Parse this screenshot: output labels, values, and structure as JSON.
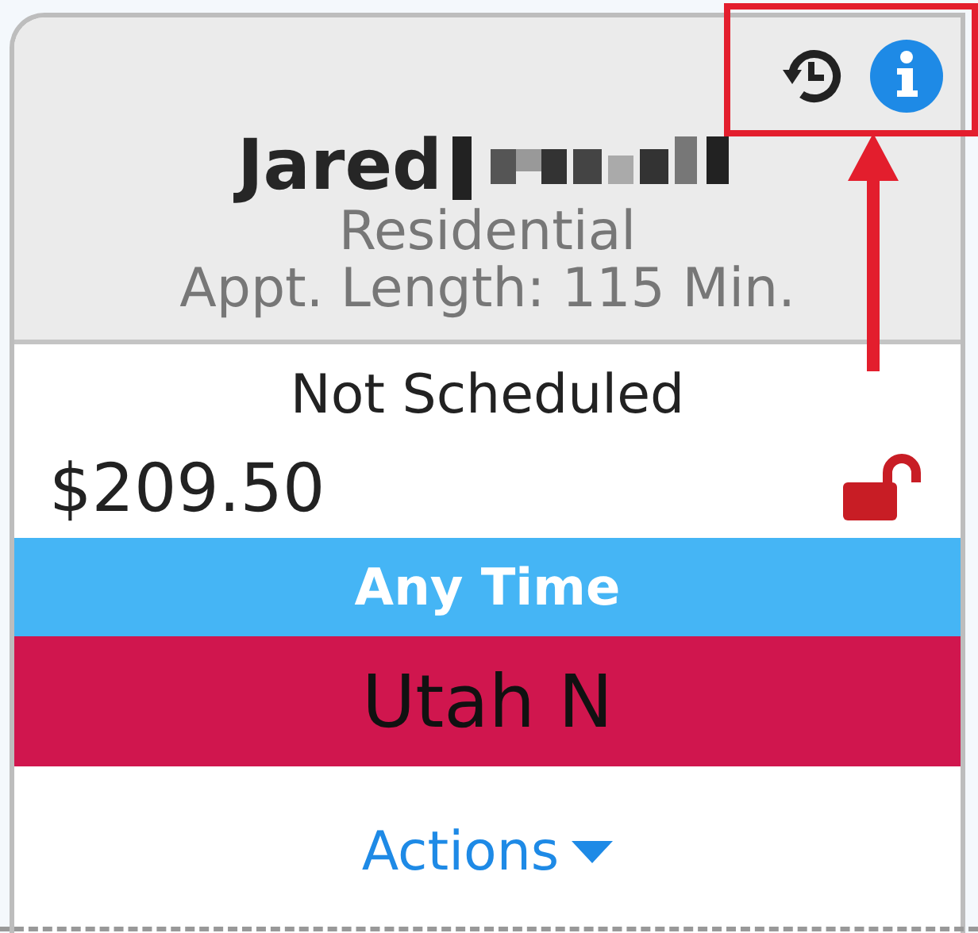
{
  "card": {
    "name": "Jared",
    "surname_redacted": true,
    "category": "Residential",
    "appointment_length": "Appt. Length: 115 Min.",
    "status": "Not Scheduled",
    "price": "$209.50",
    "price_locked": false,
    "time_window": "Any Time",
    "technician": "Utah N",
    "actions": "Actions"
  }
}
